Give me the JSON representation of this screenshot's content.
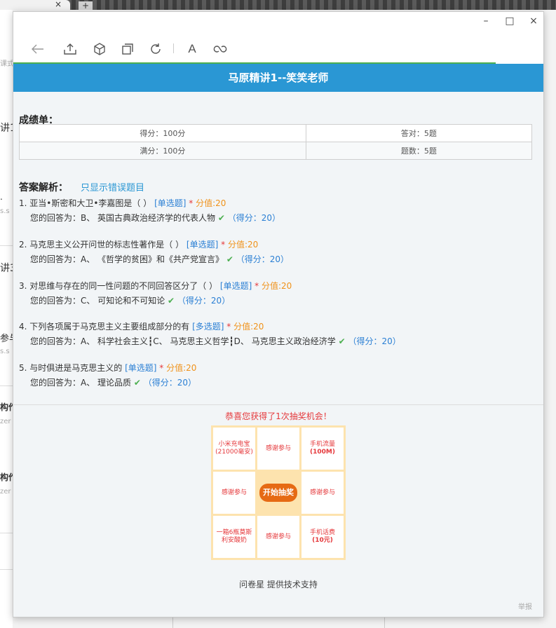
{
  "browser": {
    "tab_close": "×",
    "new_tab": "+",
    "left_fragments": [
      "课式",
      "讲1",
      ".",
      "s.s",
      "讲3",
      "参与",
      "s.s",
      "构作",
      "zer",
      "构作",
      "zer"
    ]
  },
  "window": {
    "minimize": "–",
    "maximize": "□",
    "close": "×",
    "progress_fraction": 0.91
  },
  "toolbar": {
    "icons": [
      "back-icon",
      "share-icon",
      "package-icon",
      "copy-icon",
      "refresh-icon",
      "font-icon",
      "link-icon"
    ],
    "font_glyph": "A"
  },
  "header": {
    "title": "马原精讲1--笑笑老师",
    "color": "#2a97d4"
  },
  "score": {
    "title": "成绩单：",
    "got": "得分：100分",
    "correct": "答对：5题",
    "full": "满分：100分",
    "count": "题数：5题"
  },
  "answers": {
    "title": "答案解析：",
    "only_wrong": "只显示错误题目",
    "questions": [
      {
        "stem": "1. 亚当•斯密和大卫•李嘉图是（ ）",
        "type": "[单选题]",
        "star": "*",
        "value": "分值:20",
        "answer": "您的回答为：B、 英国古典政治经济学的代表人物",
        "score": "（得分：20）"
      },
      {
        "stem": "2. 马克思主义公开问世的标志性著作是（ ）",
        "type": "[单选题]",
        "star": "*",
        "value": "分值:20",
        "answer": "您的回答为：A、 《哲学的贫困》和《共产党宣言》",
        "score": "（得分：20）"
      },
      {
        "stem": "3. 对思维与存在的同一性问题的不同回答区分了（ ）",
        "type": "[单选题]",
        "star": "*",
        "value": "分值:20",
        "answer": "您的回答为：C、 可知论和不可知论",
        "score": "（得分：20）"
      },
      {
        "stem": "4. 下列各项属于马克思主义主要组成部分的有",
        "type": "[多选题]",
        "star": "*",
        "value": "分值:20",
        "answer": "您的回答为：A、 科学社会主义┇C、 马克思主义哲学┇D、 马克思主义政治经济学",
        "score": "（得分：20）"
      },
      {
        "stem": "5. 与时俱进是马克思主义的",
        "type": "[单选题]",
        "star": "*",
        "value": "分值:20",
        "answer": "您的回答为：A、 理论品质",
        "score": "（得分：20）"
      }
    ]
  },
  "lottery": {
    "title": "恭喜您获得了1次抽奖机会！",
    "cells": {
      "c1a": "小米充电宝",
      "c1b": "(21000毫安)",
      "c2": "感谢参与",
      "c3a": "手机流量",
      "c3b": "(100M)",
      "c4": "感谢参与",
      "c6": "感谢参与",
      "c7a": "一箱6瓶莫斯",
      "c7b": "利安酸奶",
      "c8": "感谢参与",
      "c9a": "手机话费",
      "c9b": "(10元)"
    },
    "start": "开始抽奖"
  },
  "footer": {
    "support": "问卷星 提供技术支持",
    "report": "举报"
  }
}
